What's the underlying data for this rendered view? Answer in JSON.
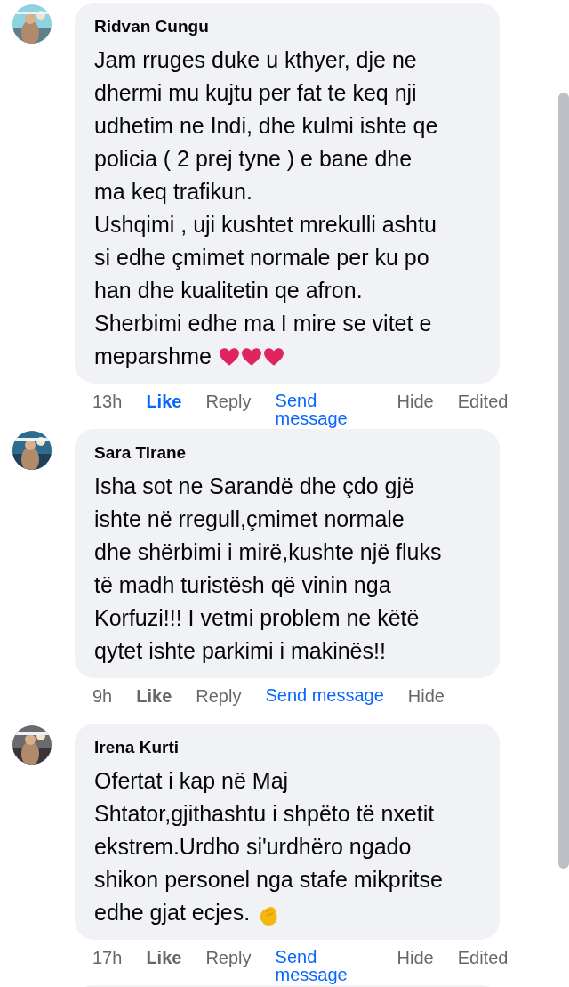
{
  "comments": [
    {
      "author": "Ridvan Cungu",
      "avatar": {
        "kind": "picture"
      },
      "lines": [
        "Jam rruges duke u kthyer, dje ne",
        "dhermi mu kujtu per fat te keq nji",
        "udhetim ne Indi, dhe kulmi ishte qe",
        "policia ( 2 prej tyne ) e bane dhe",
        "ma keq trafikun.",
        "Ushqimi , uji kushtet mrekulli ashtu",
        "si edhe çmimet normale per ku po",
        "han dhe kualitetin qe afron.",
        "Sherbimi edhe ma I mire se vitet e",
        "meparshme"
      ],
      "emoji": [
        {
          "kind": "heart"
        },
        {
          "kind": "heart"
        },
        {
          "kind": "heart"
        }
      ],
      "actions": {
        "time": "13h",
        "like": "Like",
        "liked": true,
        "reply": "Reply",
        "send": "Send message",
        "hide": "Hide",
        "edited": "Edited"
      }
    },
    {
      "author": "Sara Tirane",
      "avatar": {
        "kind": "picture"
      },
      "lines": [
        "Isha sot ne Sarandë dhe çdo gjë",
        "ishte në rregull,çmimet normale",
        "dhe shërbimi i mirë,kushte një fluks",
        "të madh turistësh që vinin nga",
        "Korfuzi!!! I vetmi problem ne këtë",
        "qytet ishte parkimi i makinës!!"
      ],
      "actions": {
        "time": "9h",
        "like": "Like",
        "liked": false,
        "reply": "Reply",
        "send": "Send message",
        "hide": "Hide"
      }
    },
    {
      "author": "Irena Kurti",
      "avatar": {
        "kind": "picture"
      },
      "lines": [
        "Ofertat i kap në Maj",
        "Shtator,gjithashtu i shpëto të nxetit",
        "ekstrem.Urdho si'urdhëro ngado",
        "shikon personel nga stafe mikpritse",
        "edhe gjat ecjes."
      ],
      "emoji": [
        {
          "kind": "clap"
        }
      ],
      "actions": {
        "time": "17h",
        "like": "Like",
        "liked": false,
        "reply": "Reply",
        "send": "Send message",
        "hide": "Hide",
        "edited": "Edited"
      }
    }
  ]
}
